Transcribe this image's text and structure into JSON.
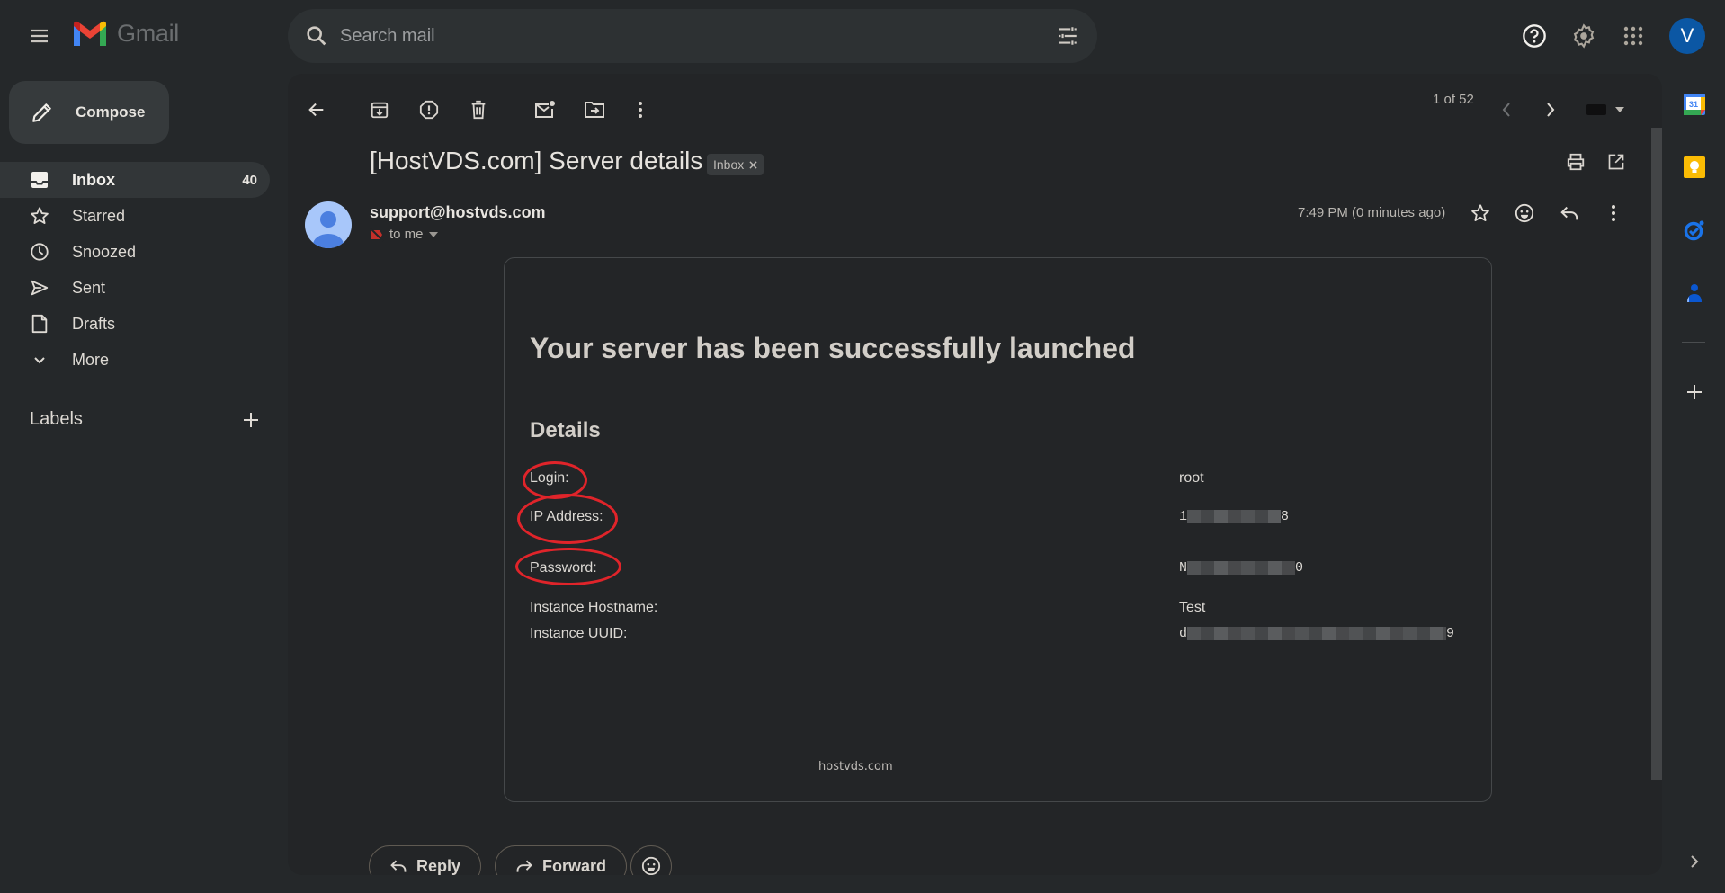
{
  "app": {
    "name": "Gmail",
    "brand_colors": {
      "red": "#ea4335",
      "blue": "#4285f4",
      "green": "#34a853",
      "yellow": "#fbbc04"
    }
  },
  "topbar": {
    "menu_icon": "hamburger-menu-icon",
    "search_placeholder": "Search mail",
    "search_value": "",
    "icons": [
      "help-icon",
      "settings-gear-icon",
      "apps-grid-icon"
    ],
    "account_initial": "V",
    "account_color": "#0b57a4"
  },
  "sidebar": {
    "compose_label": "Compose",
    "items": [
      {
        "label": "Inbox",
        "icon": "inbox-icon",
        "count": "40",
        "active": true
      },
      {
        "label": "Starred",
        "icon": "star-icon",
        "count": "",
        "active": false
      },
      {
        "label": "Snoozed",
        "icon": "clock-icon",
        "count": "",
        "active": false
      },
      {
        "label": "Sent",
        "icon": "send-icon",
        "count": "",
        "active": false
      },
      {
        "label": "Drafts",
        "icon": "draft-icon",
        "count": "",
        "active": false
      },
      {
        "label": "More",
        "icon": "chevron-down-icon",
        "count": "",
        "active": false
      }
    ],
    "labels_title": "Labels"
  },
  "toolbar": {
    "actions": [
      "back",
      "archive",
      "report-spam",
      "delete",
      "mark-unread",
      "move-to",
      "more"
    ],
    "pager": "1 of 52"
  },
  "message": {
    "subject": "[HostVDS.com] Server details",
    "label_chip": "Inbox",
    "sender": "support@hostvds.com",
    "recipient": "to me",
    "timestamp": "7:49 PM (0 minutes ago)",
    "body": {
      "headline": "Your server has been successfully launched",
      "section_title": "Details",
      "rows": [
        {
          "label": "Login:",
          "value_start": "root",
          "value_end": "",
          "redacted": false,
          "circled": true
        },
        {
          "label": "IP Address:",
          "value_start": "1",
          "value_end": "8",
          "redacted": true,
          "circled": true
        },
        {
          "label": "Password:",
          "value_start": "N",
          "value_end": "0",
          "redacted": true,
          "circled": true
        },
        {
          "label": "Instance Hostname:",
          "value_start": "Test",
          "value_end": "",
          "redacted": false,
          "circled": false
        },
        {
          "label": "Instance UUID:",
          "value_start": "d",
          "value_end": "9",
          "redacted": true,
          "circled": false
        }
      ],
      "footer_link": "hostvds.com"
    }
  },
  "actions": {
    "reply_label": "Reply",
    "forward_label": "Forward"
  },
  "right_rail": [
    "calendar-icon",
    "keep-icon",
    "tasks-icon",
    "contacts-icon",
    "add-addon-icon"
  ],
  "calendar_day": "31"
}
